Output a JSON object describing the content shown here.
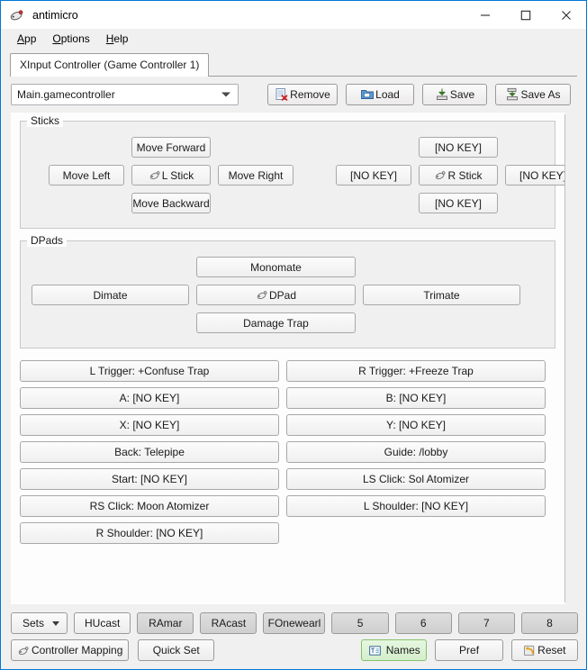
{
  "window": {
    "title": "antimicro",
    "icon": "gamepad-icon",
    "controls": {
      "minimize": "minimize-icon",
      "maximize": "maximize-icon",
      "close": "close-icon"
    }
  },
  "menubar": {
    "items": [
      {
        "label": "App",
        "mnemonic": "A",
        "rest": "pp"
      },
      {
        "label": "Options",
        "mnemonic": "O",
        "rest": "ptions"
      },
      {
        "label": "Help",
        "mnemonic": "H",
        "rest": "elp"
      }
    ]
  },
  "tabs": [
    {
      "label": "XInput Controller (Game Controller 1)",
      "active": true
    }
  ],
  "toolbar": {
    "profile_value": "Main.gamecontroller",
    "remove_label": "Remove",
    "load_label": "Load",
    "save_label": "Save",
    "saveas_label": "Save As"
  },
  "sticks": {
    "title": "Sticks",
    "left": {
      "up": "Move Forward",
      "left": "Move Left",
      "center": "L Stick",
      "right": "Move Right",
      "down": "Move Backward"
    },
    "right": {
      "up": "[NO KEY]",
      "left": "[NO KEY]",
      "center": "R Stick",
      "right": "[NO KEY]",
      "down": "[NO KEY]"
    }
  },
  "dpads": {
    "title": "DPads",
    "up": "Monomate",
    "left": "Dimate",
    "center": "DPad",
    "right": "Trimate",
    "down": "Damage Trap"
  },
  "buttons": [
    "L Trigger: +Confuse Trap",
    "R Trigger: +Freeze Trap",
    "A: [NO KEY]",
    "B: [NO KEY]",
    "X: [NO KEY]",
    "Y: [NO KEY]",
    "Back: Telepipe",
    "Guide: /lobby",
    "Start: [NO KEY]",
    "LS Click: Sol Atomizer",
    "RS Click: Moon Atomizer",
    "L Shoulder: [NO KEY]",
    "R Shoulder: [NO KEY]"
  ],
  "sets": {
    "menu_label": "Sets",
    "items": [
      {
        "label": "HUcast",
        "selected": true
      },
      {
        "label": "RAmar",
        "selected": false
      },
      {
        "label": "RAcast",
        "selected": false
      },
      {
        "label": "FOnewearl",
        "selected": false
      },
      {
        "label": "5",
        "selected": false
      },
      {
        "label": "6",
        "selected": false
      },
      {
        "label": "7",
        "selected": false
      },
      {
        "label": "8",
        "selected": false
      }
    ]
  },
  "actions": {
    "mapping_label": "Controller Mapping",
    "quickset_label": "Quick Set",
    "names_label": "Names",
    "names_active": true,
    "pref_label": "Pref",
    "reset_label": "Reset"
  },
  "colors": {
    "accent": "#0078d7",
    "window_bg": "#f0f0f0",
    "content_bg": "#fdfdfd",
    "group_bg": "#f0f0f0",
    "active_green": "#d4eecb"
  }
}
